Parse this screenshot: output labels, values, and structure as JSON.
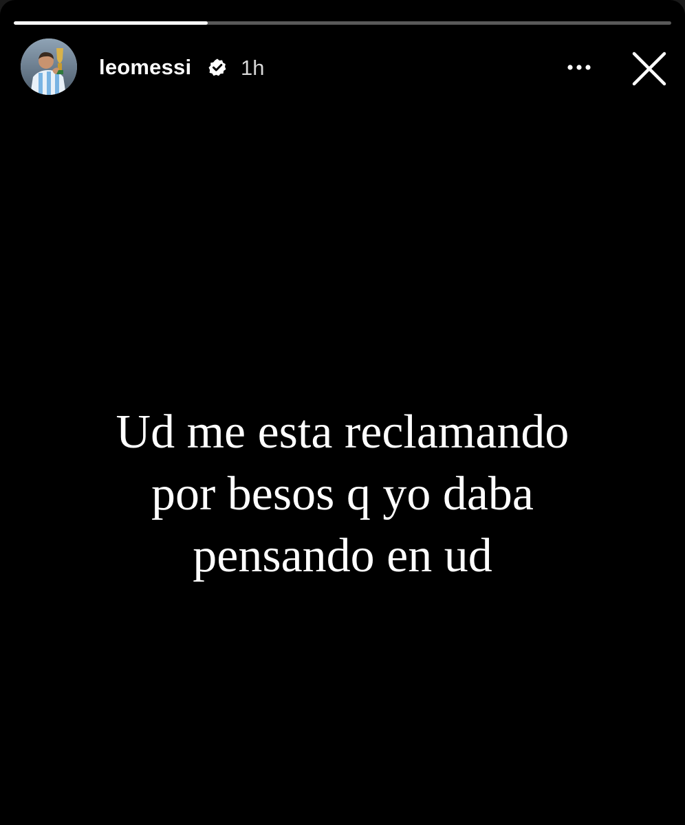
{
  "story": {
    "progress": 0.295,
    "user": {
      "username": "leomessi",
      "verified": true,
      "time_ago": "1h"
    },
    "actions": {
      "more_icon": "more-horizontal-icon",
      "close_icon": "close-icon"
    },
    "text_lines": [
      "Ud me esta reclamando",
      "por besos q yo daba",
      "pensando en ud"
    ]
  },
  "colors": {
    "background": "#000000",
    "text": "#ffffff",
    "progress_track": "rgba(255,255,255,0.35)",
    "progress_fill": "#ffffff"
  }
}
